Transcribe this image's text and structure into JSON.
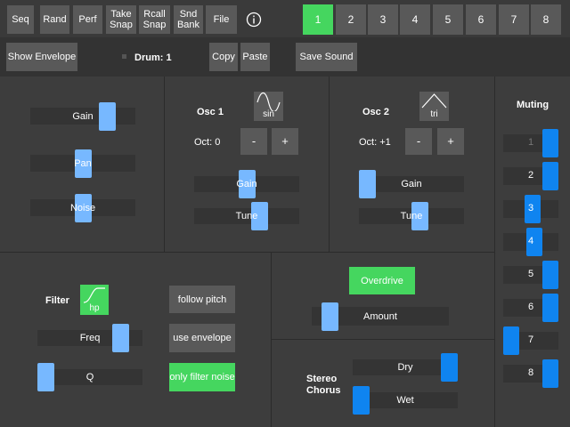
{
  "toolbar": {
    "seq": "Seq",
    "rand": "Rand",
    "perf": "Perf",
    "take_snap": "Take Snap",
    "rcall_snap": "Rcall Snap",
    "snd_bank": "Snd Bank",
    "file": "File",
    "info_icon": "info-icon"
  },
  "drum_tabs": [
    "1",
    "2",
    "3",
    "4",
    "5",
    "6",
    "7",
    "8"
  ],
  "selected_tab": "1",
  "second_bar": {
    "show_envelope": "Show Envelope",
    "drum_label": "Drum: 1",
    "copy": "Copy",
    "paste": "Paste",
    "save_sound": "Save Sound"
  },
  "mixer": {
    "gain": {
      "label": "Gain",
      "value": 0.78
    },
    "pan": {
      "label": "Pan",
      "value": 0.5
    },
    "noise": {
      "label": "Noise",
      "value": 0.5
    }
  },
  "osc1": {
    "title": "Osc 1",
    "wave": "sin",
    "wave_icon": "sine-wave-icon",
    "oct": "Oct: 0",
    "minus": "-",
    "plus": "+",
    "gain": {
      "label": "Gain",
      "value": 0.5
    },
    "tune": {
      "label": "Tune",
      "value": 0.65
    }
  },
  "osc2": {
    "title": "Osc 2",
    "wave": "tri",
    "wave_icon": "triangle-wave-icon",
    "oct": "Oct: +1",
    "minus": "-",
    "plus": "+",
    "gain": {
      "label": "Gain",
      "value": 0.0
    },
    "tune": {
      "label": "Tune",
      "value": 0.6
    }
  },
  "muting": {
    "title": "Muting",
    "rows": [
      {
        "label": "1",
        "value": 1.0,
        "dim": true
      },
      {
        "label": "2",
        "value": 1.0
      },
      {
        "label": "3",
        "value": 0.55
      },
      {
        "label": "4",
        "value": 0.6
      },
      {
        "label": "5",
        "value": 1.0
      },
      {
        "label": "6",
        "value": 1.0
      },
      {
        "label": "7",
        "value": 0.0
      },
      {
        "label": "8",
        "value": 1.0
      }
    ]
  },
  "filter": {
    "title": "Filter",
    "type": "hp",
    "type_icon": "highpass-filter-icon",
    "freq": {
      "label": "Freq",
      "value": 0.85
    },
    "q": {
      "label": "Q",
      "value": 0.0
    },
    "follow_pitch": "follow pitch",
    "use_envelope": "use envelope",
    "only_filter_noise": "only filter noise"
  },
  "overdrive": {
    "button": "Overdrive",
    "amount": {
      "label": "Amount",
      "value": 0.08
    }
  },
  "chorus": {
    "title": "Stereo Chorus",
    "dry": {
      "label": "Dry",
      "value": 1.0
    },
    "wet": {
      "label": "Wet",
      "value": 0.0
    }
  },
  "colors": {
    "accent_green": "#45d65f",
    "thumb_blue": "#77b8ff",
    "thumb_deep_blue": "#0f84f0",
    "button_gray": "#595959"
  }
}
